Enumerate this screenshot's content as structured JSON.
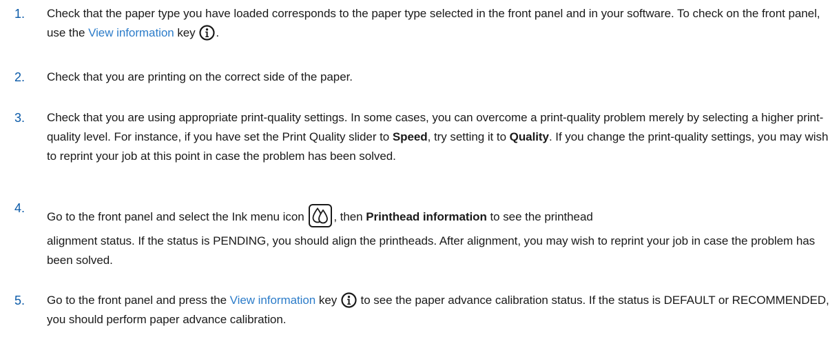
{
  "steps": [
    {
      "number": "1.",
      "text_a": "Check that the paper type you have loaded corresponds to the paper type selected in the front panel and in your software. To check on the front panel, use the ",
      "link": "View information",
      "text_b": " key ",
      "text_c": "."
    },
    {
      "number": "2.",
      "text": "Check that you are printing on the correct side of the paper."
    },
    {
      "number": "3.",
      "text_a": "Check that you are using appropriate print-quality settings. In some cases, you can overcome a print-quality problem merely by selecting a higher print-quality level. For instance, if you have set the Print Quality slider to ",
      "bold_a": "Speed",
      "text_b": ", try setting it to ",
      "bold_b": "Quality",
      "text_c": ". If you change the print-quality settings, you may wish to reprint your job at this point in case the problem has been solved."
    },
    {
      "number": "4.",
      "text_a": "Go to the front panel and select the Ink menu icon ",
      "text_b": ", then ",
      "bold_a": "Printhead information",
      "text_c": " to see the printhead",
      "text_d": "alignment status. If the status is PENDING, you should align the printheads. After alignment, you may wish to reprint your job in case the problem has been solved."
    },
    {
      "number": "5.",
      "text_a": "Go to the front panel and press the ",
      "link": "View information",
      "text_b": " key ",
      "text_c": " to see the paper advance calibration status. If the status is DEFAULT or RECOMMENDED, you should perform paper advance calibration."
    }
  ],
  "icons": {
    "info": "info-icon",
    "ink": "ink-menu-icon"
  },
  "colors": {
    "number": "#0a5aa8",
    "link": "#2c7cc9",
    "text": "#1a1a1a"
  }
}
